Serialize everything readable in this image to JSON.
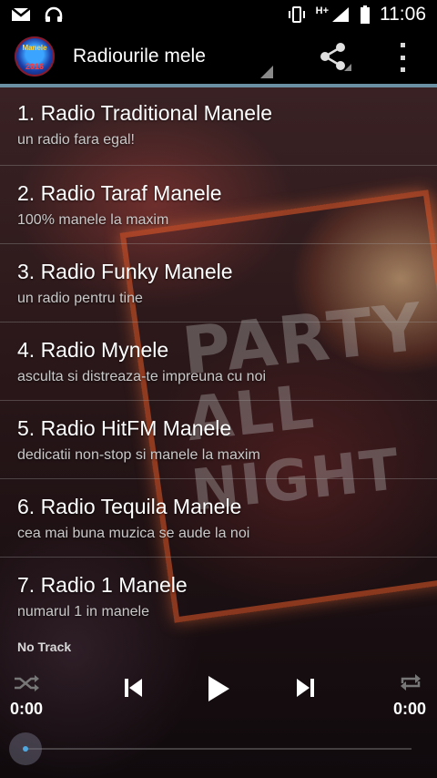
{
  "status_bar": {
    "time": "11:06",
    "network_label": "H+",
    "left_icons": [
      "gmail-icon",
      "headset-icon"
    ],
    "right_icons": [
      "vibrate-icon",
      "signal-icon",
      "battery-icon"
    ]
  },
  "action_bar": {
    "logo_text": "Manele",
    "logo_year": "2016",
    "title": "Radiourile mele",
    "actions": [
      "share-icon",
      "overflow-menu-icon"
    ]
  },
  "stations": [
    {
      "name": "1. Radio Traditional Manele",
      "desc": "un radio fara egal!"
    },
    {
      "name": "2. Radio Taraf Manele",
      "desc": "100% manele la maxim"
    },
    {
      "name": "3. Radio Funky Manele",
      "desc": "un radio pentru tine"
    },
    {
      "name": "4. Radio Mynele",
      "desc": "asculta si distreaza-te impreuna cu noi"
    },
    {
      "name": "5. Radio HitFM Manele",
      "desc": "dedicatii non-stop si manele la maxim"
    },
    {
      "name": "6. Radio Tequila Manele",
      "desc": "cea mai buna muzica se aude la noi"
    },
    {
      "name": "7. Radio 1 Manele",
      "desc": "numarul 1 in manele"
    }
  ],
  "player": {
    "track": "No Track",
    "time_elapsed": "0:00",
    "time_total": "0:00",
    "progress": 0
  },
  "background_art": {
    "lines": [
      "PARTY",
      "ALL",
      "NIGHT"
    ]
  },
  "colors": {
    "accent_line": "#6b8fa3",
    "seek_dot": "#4fa8e0"
  }
}
